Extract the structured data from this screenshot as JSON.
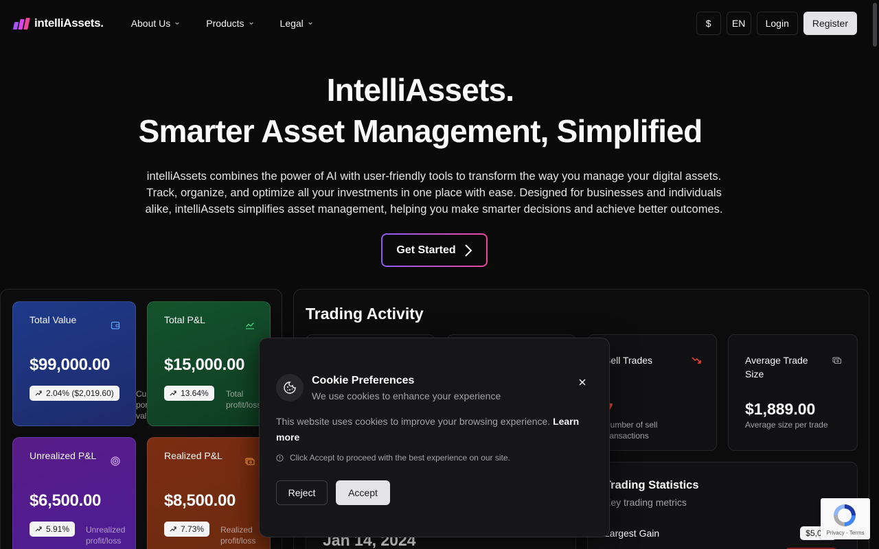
{
  "brand": {
    "name": "intelliAssets.",
    "logo_colors": [
      "#a855f7",
      "#d946ef",
      "#ec4899"
    ]
  },
  "nav": {
    "items": [
      {
        "label": "About Us"
      },
      {
        "label": "Products"
      },
      {
        "label": "Legal"
      }
    ],
    "currency": "$",
    "language": "EN",
    "login": "Login",
    "register": "Register"
  },
  "hero": {
    "title_line1": "IntelliAssets.",
    "title_line2": "Smarter Asset Management, Simplified",
    "description": "intelliAssets combines the power of AI with user-friendly tools to transform the way you manage your digital assets. Track, organize, and optimize all your investments in one place with ease. Designed for businesses and individuals alike, intelliAssets simplifies asset management, helping you make smarter decisions and achieve better outcomes.",
    "cta": "Get Started"
  },
  "portfolio_cards": [
    {
      "title": "Total Value",
      "value": "$99,000.00",
      "change": "2.04% ($2,019.60)",
      "sub": "Current portfolio value",
      "icon": "wallet-icon",
      "accent": "#3b82f6"
    },
    {
      "title": "Total P&L",
      "value": "$15,000.00",
      "change": "13.64%",
      "sub": "Total profit/loss",
      "icon": "chart-line-icon",
      "accent": "#22c55e"
    },
    {
      "title": "Unrealized P&L",
      "value": "$6,500.00",
      "change": "5.91%",
      "sub": "Unrealized profit/loss",
      "icon": "target-icon",
      "accent": "#c084fc"
    },
    {
      "title": "Realized P&L",
      "value": "$8,500.00",
      "change": "7.73%",
      "sub": "Realized profit/loss",
      "icon": "cash-icon",
      "accent": "#f97316"
    }
  ],
  "trading": {
    "title": "Trading Activity",
    "sell_trades": {
      "title": "Sell Trades",
      "value": "7",
      "sub": "Number of sell transactions",
      "icon": "trend-down-icon"
    },
    "avg_trade": {
      "title": "Average Trade Size",
      "value": "$1,889.00",
      "sub": "Average size per trade",
      "icon": "coins-icon"
    },
    "date_value": "Jan 14, 2024",
    "stats": {
      "title": "Trading Statistics",
      "sub": "Key trading metrics",
      "largest_gain_label": "Largest Gain",
      "largest_gain_value": "$5,000"
    }
  },
  "cookie": {
    "title": "Cookie Preferences",
    "subtitle": "We use cookies to enhance your experience",
    "body": "This website uses cookies to improve your browsing experience.",
    "learn_more": "Learn more",
    "note": "Click Accept to proceed with the best experience on our site.",
    "reject": "Reject",
    "accept": "Accept"
  },
  "recaptcha": {
    "links": "Privacy - Terms"
  }
}
